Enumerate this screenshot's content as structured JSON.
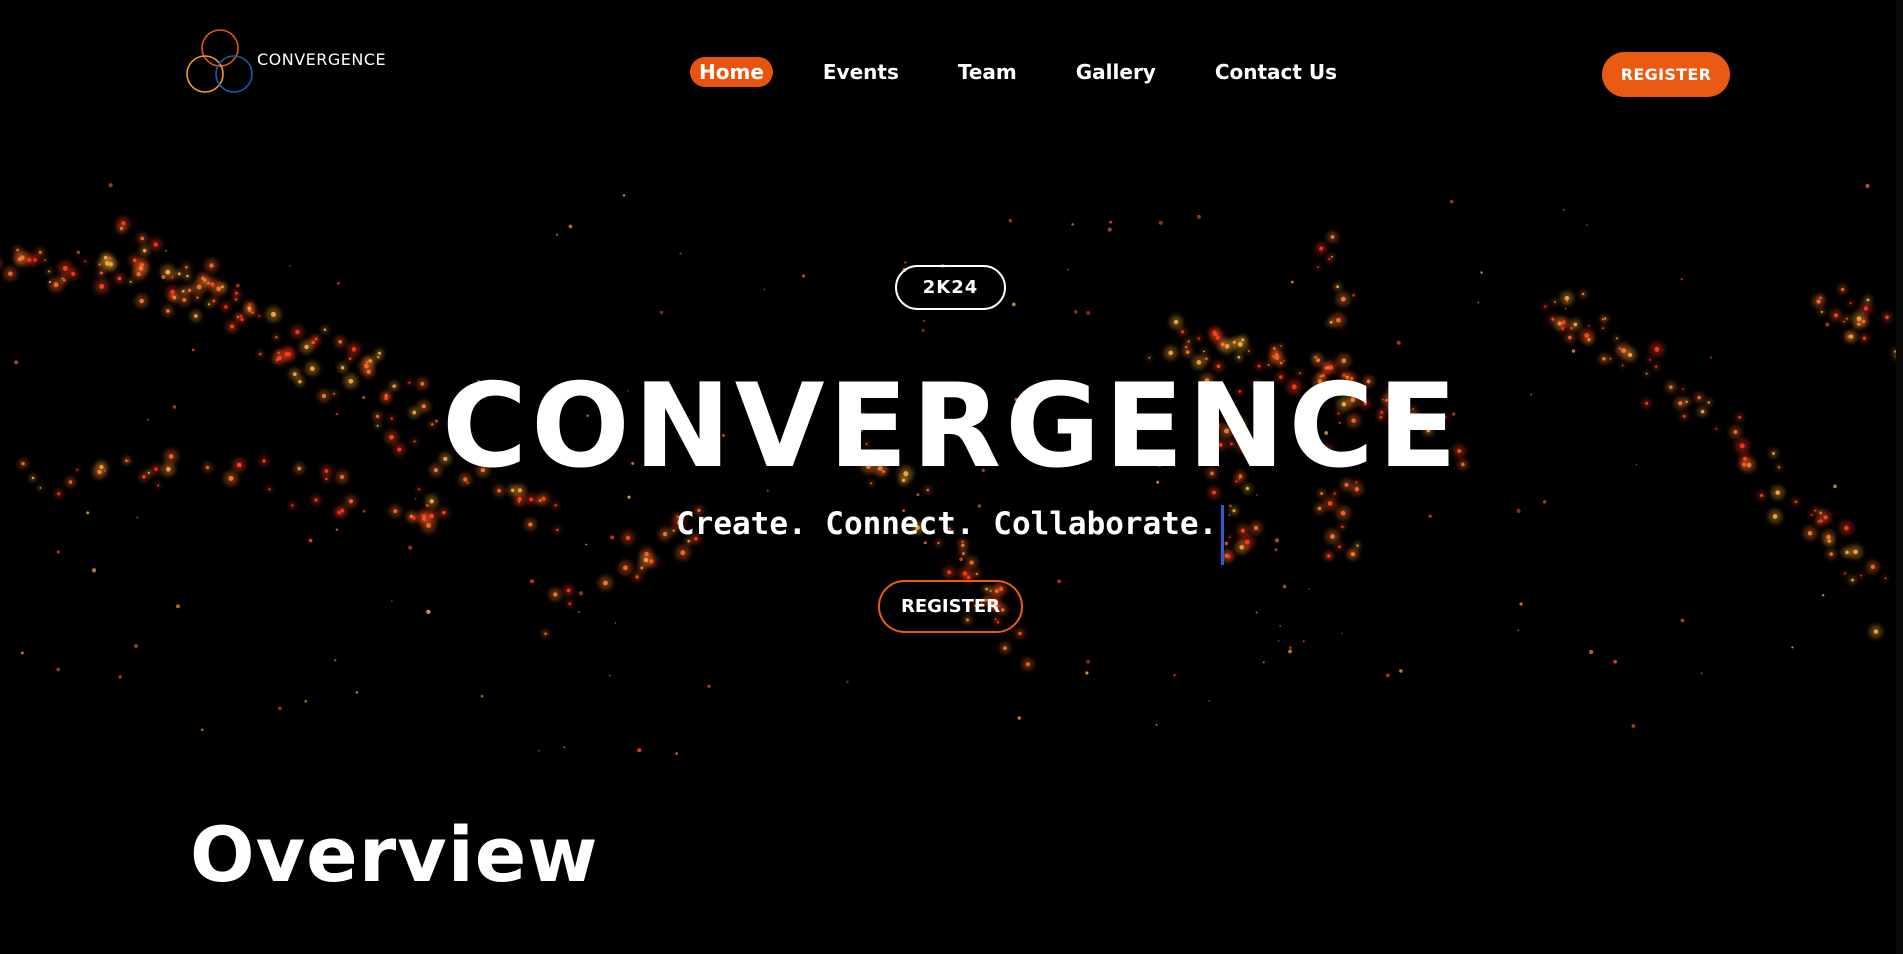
{
  "brand": {
    "name": "CONVERGENCE",
    "logo_colors": [
      "#e8531a",
      "#f39a1e",
      "#1e5aa8"
    ]
  },
  "nav": {
    "items": [
      {
        "label": "Home",
        "active": true
      },
      {
        "label": "Events",
        "active": false
      },
      {
        "label": "Team",
        "active": false
      },
      {
        "label": "Gallery",
        "active": false
      },
      {
        "label": "Contact Us",
        "active": false
      }
    ]
  },
  "header": {
    "register_label": "REGISTER"
  },
  "hero": {
    "badge": "2K24",
    "title": "CONVERGENCE",
    "tagline": "Create. Connect. Collaborate.",
    "register_label": "REGISTER"
  },
  "overview": {
    "heading": "Overview"
  },
  "colors": {
    "accent": "#ea5a12",
    "background": "#000000",
    "text": "#ffffff",
    "cursor": "#2a5fd0"
  }
}
